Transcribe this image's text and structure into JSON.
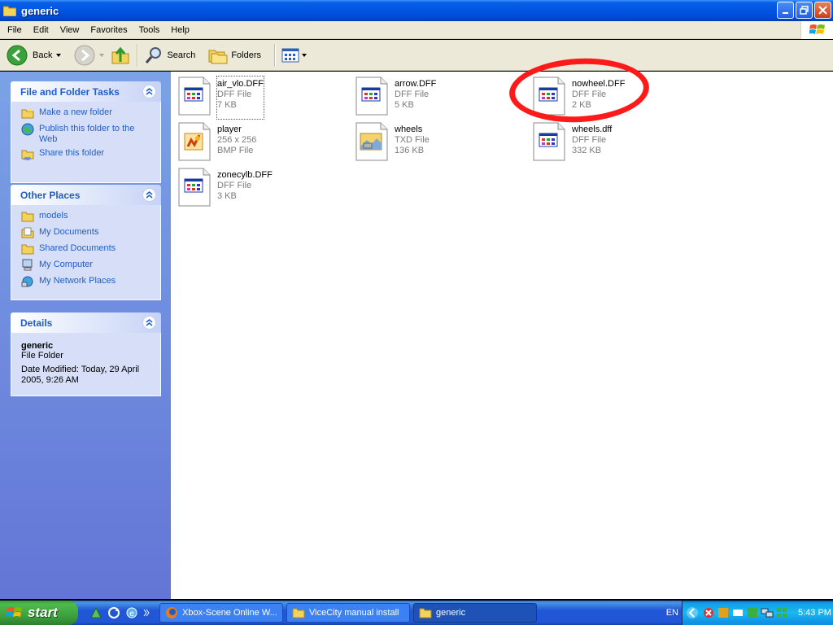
{
  "window": {
    "title": "generic"
  },
  "menu": [
    "File",
    "Edit",
    "View",
    "Favorites",
    "Tools",
    "Help"
  ],
  "toolbar": {
    "back": "Back",
    "search": "Search",
    "folders": "Folders"
  },
  "file_tasks": {
    "title": "File and Folder Tasks",
    "items": [
      "Make a new folder",
      "Publish this folder to the Web",
      "Share this folder"
    ]
  },
  "other_places": {
    "title": "Other Places",
    "items": [
      "models",
      "My Documents",
      "Shared Documents",
      "My Computer",
      "My Network Places"
    ]
  },
  "details": {
    "title": "Details",
    "name": "generic",
    "type": "File Folder",
    "modified": "Date Modified: Today, 29 April 2005, 9:26 AM"
  },
  "files": [
    {
      "name": "air_vlo.DFF",
      "line2": "DFF File",
      "line3": "7 KB",
      "icon": "dff-file-icon"
    },
    {
      "name": "arrow.DFF",
      "line2": "DFF File",
      "line3": "5 KB",
      "icon": "dff-file-icon"
    },
    {
      "name": "nowheel.DFF",
      "line2": "DFF File",
      "line3": "2 KB",
      "icon": "dff-file-icon"
    },
    {
      "name": "player",
      "line2": "256 x 256",
      "line3": "BMP File",
      "icon": "bmp-file-icon"
    },
    {
      "name": "wheels",
      "line2": "TXD File",
      "line3": "136 KB",
      "icon": "txd-file-icon"
    },
    {
      "name": "wheels.dff",
      "line2": "DFF File",
      "line3": "332 KB",
      "icon": "dff-file-icon"
    },
    {
      "name": "zonecylb.DFF",
      "line2": "DFF File",
      "line3": "3 KB",
      "icon": "dff-file-icon"
    }
  ],
  "taskbar": {
    "start": "start",
    "tasks": [
      "Xbox-Scene Online W...",
      "ViceCity manual install",
      "generic"
    ],
    "language": "EN",
    "clock": "5:43 PM"
  },
  "colors": {
    "annotation": "#ff1a1a",
    "link": "#215dc6",
    "titlebar": "#0054e3"
  }
}
